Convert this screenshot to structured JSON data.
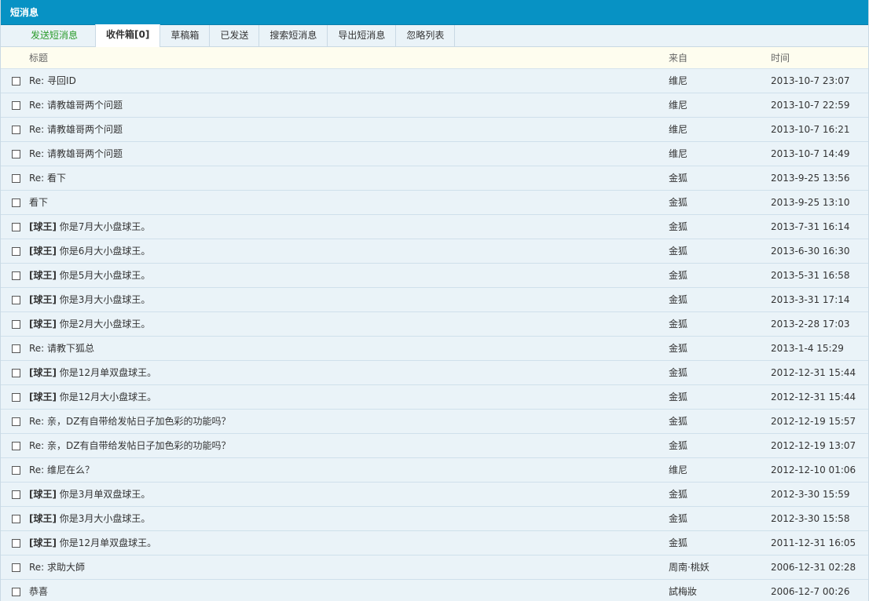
{
  "header": {
    "title": "短消息"
  },
  "tabs": [
    {
      "label": "发送短消息"
    },
    {
      "label": "收件箱[0]"
    },
    {
      "label": "草稿箱"
    },
    {
      "label": "已发送"
    },
    {
      "label": "搜索短消息"
    },
    {
      "label": "导出短消息"
    },
    {
      "label": "忽略列表"
    }
  ],
  "columns": {
    "subject": "标题",
    "from": "来自",
    "time": "时间"
  },
  "messages": [
    {
      "tag": "",
      "subject": "Re: 寻回ID",
      "from": "维尼",
      "time": "2013-10-7 23:07"
    },
    {
      "tag": "",
      "subject": "Re: 请教雄哥两个问题",
      "from": "维尼",
      "time": "2013-10-7 22:59"
    },
    {
      "tag": "",
      "subject": "Re: 请教雄哥两个问题",
      "from": "维尼",
      "time": "2013-10-7 16:21"
    },
    {
      "tag": "",
      "subject": "Re: 请教雄哥两个问题",
      "from": "维尼",
      "time": "2013-10-7 14:49"
    },
    {
      "tag": "",
      "subject": "Re: 看下",
      "from": "金狐",
      "time": "2013-9-25 13:56"
    },
    {
      "tag": "",
      "subject": "看下",
      "from": "金狐",
      "time": "2013-9-25 13:10"
    },
    {
      "tag": "[球王]",
      "subject": " 你是7月大小盘球王。",
      "from": "金狐",
      "time": "2013-7-31 16:14"
    },
    {
      "tag": "[球王]",
      "subject": " 你是6月大小盘球王。",
      "from": "金狐",
      "time": "2013-6-30 16:30"
    },
    {
      "tag": "[球王]",
      "subject": " 你是5月大小盘球王。",
      "from": "金狐",
      "time": "2013-5-31 16:58"
    },
    {
      "tag": "[球王]",
      "subject": " 你是3月大小盘球王。",
      "from": "金狐",
      "time": "2013-3-31 17:14"
    },
    {
      "tag": "[球王]",
      "subject": " 你是2月大小盘球王。",
      "from": "金狐",
      "time": "2013-2-28 17:03"
    },
    {
      "tag": "",
      "subject": "Re: 请教下狐总",
      "from": "金狐",
      "time": "2013-1-4 15:29"
    },
    {
      "tag": "[球王]",
      "subject": " 你是12月单双盘球王。",
      "from": "金狐",
      "time": "2012-12-31 15:44"
    },
    {
      "tag": "[球王]",
      "subject": " 你是12月大小盘球王。",
      "from": "金狐",
      "time": "2012-12-31 15:44"
    },
    {
      "tag": "",
      "subject": "Re: 亲，DZ有自带给发帖日子加色彩的功能吗？",
      "from": "金狐",
      "time": "2012-12-19 15:57"
    },
    {
      "tag": "",
      "subject": "Re: 亲，DZ有自带给发帖日子加色彩的功能吗？",
      "from": "金狐",
      "time": "2012-12-19 13:07"
    },
    {
      "tag": "",
      "subject": "Re: 维尼在么？",
      "from": "维尼",
      "time": "2012-12-10 01:06"
    },
    {
      "tag": "[球王]",
      "subject": " 你是3月单双盘球王。",
      "from": "金狐",
      "time": "2012-3-30 15:59"
    },
    {
      "tag": "[球王]",
      "subject": " 你是3月大小盘球王。",
      "from": "金狐",
      "time": "2012-3-30 15:58"
    },
    {
      "tag": "[球王]",
      "subject": " 你是12月单双盘球王。",
      "from": "金狐",
      "time": "2011-12-31 16:05"
    },
    {
      "tag": "",
      "subject": "Re: 求助大師",
      "from": "周南·桃妖",
      "time": "2006-12-31 02:28"
    },
    {
      "tag": "",
      "subject": "恭喜",
      "from": "試梅妝",
      "time": "2006-12-7 00:26"
    }
  ],
  "colors": {
    "titlebar": "#0792c4",
    "row_bg": "#eaf3f8",
    "header_bg": "#fefdef",
    "send_link": "#2a9b2a"
  }
}
